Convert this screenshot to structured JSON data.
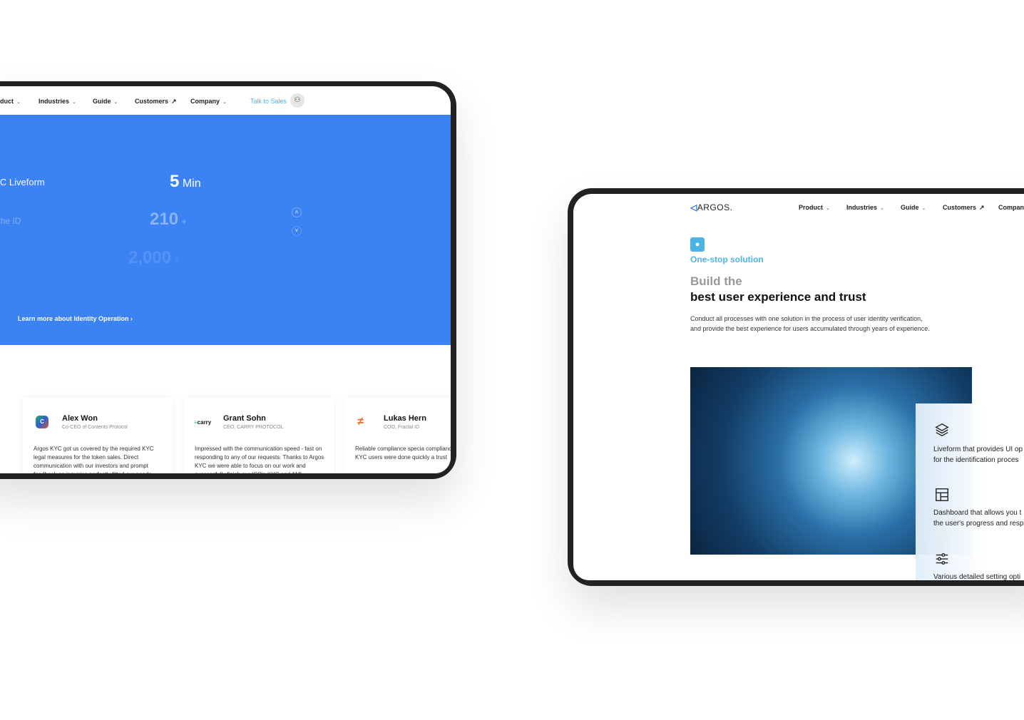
{
  "left_tablet": {
    "nav": [
      "Product",
      "Industries",
      "Guide",
      "Customers",
      "Company"
    ],
    "talk_to_sales": "Talk to Sales",
    "stats": [
      {
        "label": "Argos KYC Liveform",
        "value": "5",
        "unit": "Min"
      },
      {
        "label": "ted for the ID",
        "value": "210",
        "unit": "+"
      },
      {
        "label": "",
        "value": "2,000",
        "unit": "+"
      }
    ],
    "learn_more": "Learn more about Identity Operation",
    "testimonials": [
      {
        "name": "Alex Won",
        "role": "Co-CEO of Contents Protocol",
        "quote": "Argos KYC got us covered by the required KYC legal measures for the token sales. Direct communication with our investors and prompt feedback on inquiries perfectly fitted our needs"
      },
      {
        "name": "Grant Sohn",
        "role": "CEO, CARRY PROTOCOL",
        "logo": "carry",
        "quote": "Impressed with the communication speed - fast on responding to any of our requests. Thanks to Argos KYC we were able to focus on our work and successfully finish our ICO's KYC and AML"
      },
      {
        "name": "Lukas Hern",
        "role": "COO, Fractal ID",
        "quote": "Reliable compliance specia compliance checks on KYC users were done quickly a trust"
      }
    ],
    "accent": "#3b82f3"
  },
  "right_tablet": {
    "logo": "ARGOS.",
    "nav": [
      "Product",
      "Industries",
      "Guide",
      "Customers",
      "Company"
    ],
    "eyebrow": "One-stop solution",
    "title_light": "Build the",
    "title_bold": "best user experience and trust",
    "description": [
      "Conduct all processes with one solution in the process of user identity verification,",
      "and provide the best experience for users accumulated through years of experience."
    ],
    "features": [
      {
        "icon": "layers-icon",
        "text": [
          "Liveform that provides UI op",
          "for the identification proces"
        ]
      },
      {
        "icon": "layout-icon",
        "text": [
          "Dashboard that allows you t",
          "the user's progress and resp"
        ]
      },
      {
        "icon": "sliders-icon",
        "text": [
          "Various detailed setting opti"
        ]
      }
    ],
    "accent": "#4bb4e6"
  }
}
